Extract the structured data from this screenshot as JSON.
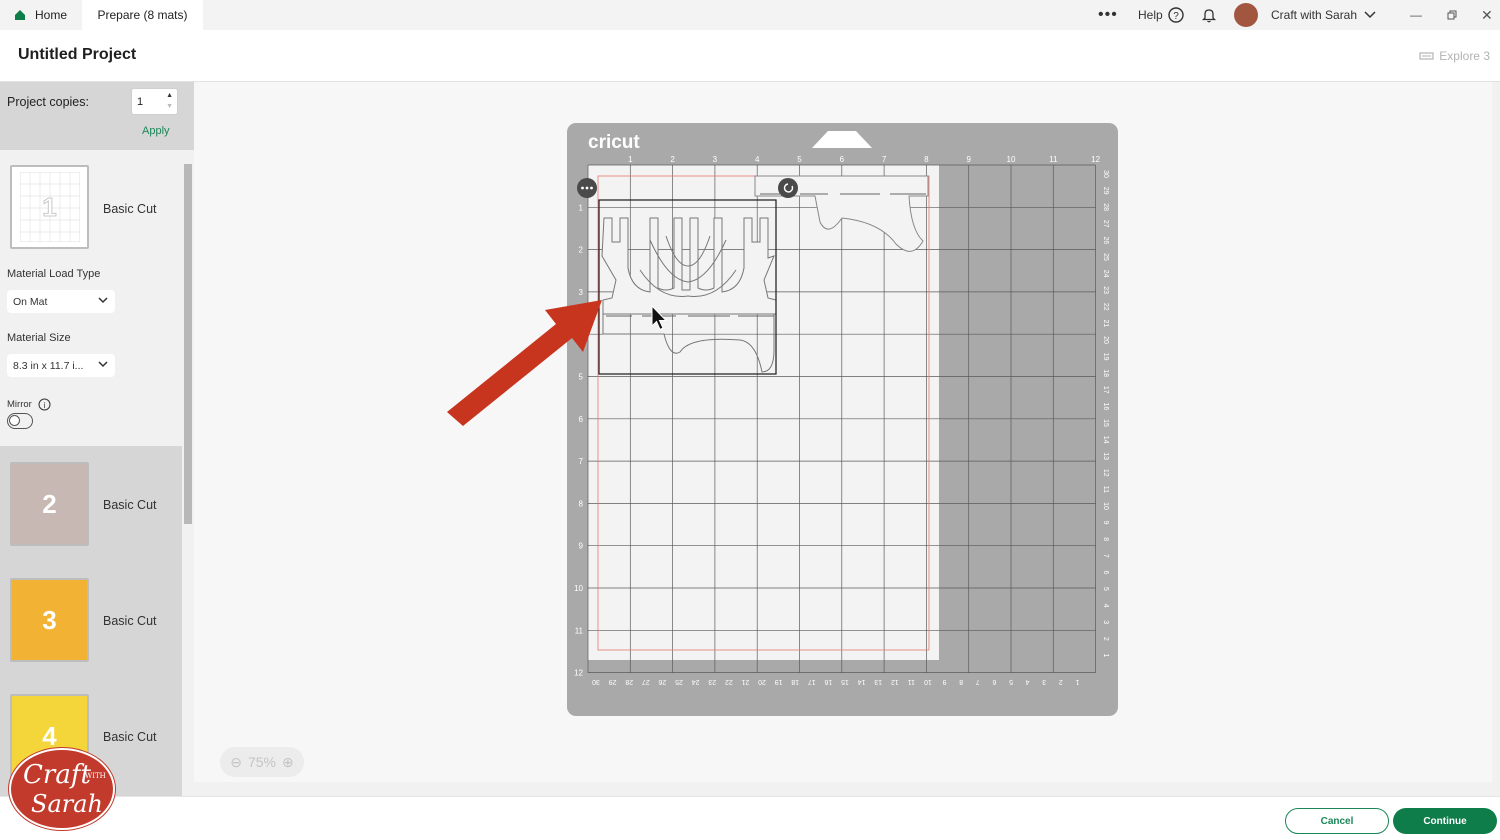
{
  "titlebar": {
    "tabs": [
      {
        "label": "Home"
      },
      {
        "label": "Prepare (8 mats)"
      }
    ],
    "help_label": "Help",
    "user_name": "Craft with Sarah",
    "more_icon": "more-horizontal-icon",
    "bell_icon": "bell-icon"
  },
  "project": {
    "title": "Untitled Project",
    "machine": "Explore 3"
  },
  "sidebar": {
    "copies_label": "Project copies:",
    "copies_value": "1",
    "apply_label": "Apply",
    "mats": [
      {
        "number": "1",
        "label": "Basic Cut",
        "color": "#ffffff"
      },
      {
        "number": "2",
        "label": "Basic Cut",
        "color": "#c8b8b4"
      },
      {
        "number": "3",
        "label": "Basic Cut",
        "color": "#f2b233"
      },
      {
        "number": "4",
        "label": "Basic Cut",
        "color": "#f4d53a"
      }
    ],
    "load_type_label": "Material Load Type",
    "load_type_value": "On Mat",
    "size_label": "Material Size",
    "size_value": "8.3 in x 11.7 i...",
    "mirror_label": "Mirror"
  },
  "mat": {
    "brand": "cricut",
    "top_ruler": [
      "1",
      "2",
      "3",
      "4",
      "5",
      "6",
      "7",
      "8",
      "9",
      "10",
      "11",
      "12"
    ],
    "left_ruler": [
      "1",
      "2",
      "3",
      "4",
      "5",
      "6",
      "7",
      "8",
      "9",
      "10",
      "11",
      "12"
    ],
    "right_ruler": [
      "30",
      "29",
      "28",
      "27",
      "26",
      "25",
      "24",
      "23",
      "22",
      "21",
      "20",
      "19",
      "18",
      "17",
      "16",
      "15",
      "14",
      "13",
      "12",
      "11",
      "10",
      "9",
      "8",
      "7",
      "6",
      "5",
      "4",
      "3",
      "2",
      "1"
    ],
    "bottom_ruler": [
      "30",
      "29",
      "28",
      "27",
      "26",
      "25",
      "24",
      "23",
      "22",
      "21",
      "20",
      "19",
      "18",
      "17",
      "16",
      "15",
      "14",
      "13",
      "12",
      "11",
      "10",
      "9",
      "8",
      "7",
      "6",
      "5",
      "4",
      "3",
      "2",
      "1"
    ],
    "colors": {
      "mat": "#a9a9a9",
      "paper": "#f3f3f3",
      "grid": "#5a5a5a",
      "arrow": "#c8351f"
    }
  },
  "zoom": {
    "value": "75%"
  },
  "footer": {
    "cancel_label": "Cancel",
    "continue_label": "Continue"
  },
  "badge": {
    "line1": "Craft",
    "line2": "WITH",
    "line3": "Sarah"
  },
  "colors": {
    "accent": "#0e7d4a",
    "accent_light": "#1a8758"
  }
}
